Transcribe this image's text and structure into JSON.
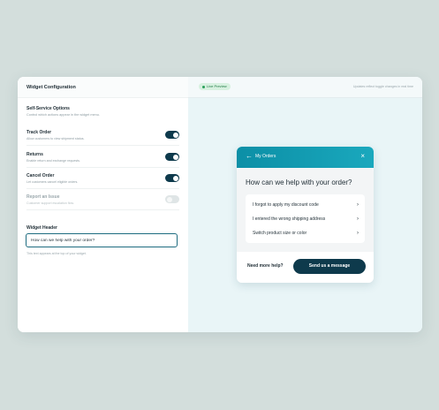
{
  "config": {
    "title": "Widget Configuration",
    "self_service": {
      "title": "Self-Service Options",
      "subtitle": "Control which actions appear in the widget menu."
    },
    "options": [
      {
        "title": "Track Order",
        "subtitle": "Allow customers to view shipment status.",
        "enabled": true
      },
      {
        "title": "Returns",
        "subtitle": "Enable return and exchange requests.",
        "enabled": true
      },
      {
        "title": "Cancel Order",
        "subtitle": "Let customers cancel eligible orders.",
        "enabled": true
      },
      {
        "title": "Report an Issue",
        "subtitle": "Customer support escalation flow.",
        "enabled": false
      }
    ],
    "widget_header": {
      "label": "Widget Header",
      "value": "How can we help with your order?",
      "help": "This text appears at the top of your widget."
    }
  },
  "preview": {
    "badge": "Live Preview",
    "updates_note": "Updates reflect toggle changes in real time",
    "widget": {
      "back_icon": "arrow-left-icon",
      "title": "My Orders",
      "close_icon": "close-icon",
      "question": "How can we help with your order?",
      "items": [
        "I forgot to apply my discount code",
        "I entered the wrong shipping address",
        "Switch product size or color"
      ],
      "need_help": "Need more help?",
      "send_label": "Send us a message"
    }
  },
  "colors": {
    "accent": "#0e3a4c",
    "teal": "#1aa8bd",
    "background": "#d3dedc"
  }
}
